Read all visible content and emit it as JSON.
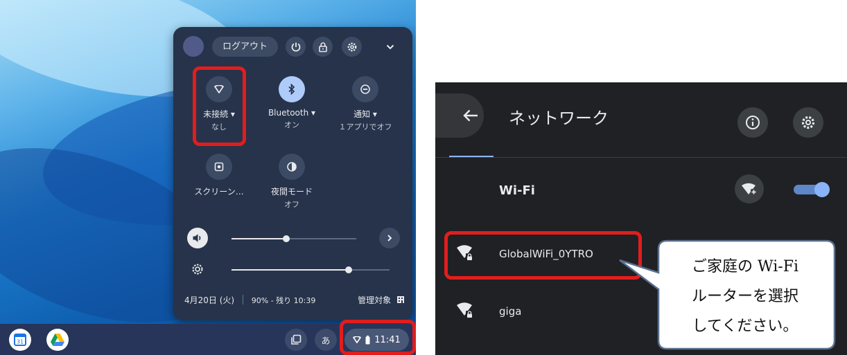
{
  "left": {
    "quick_settings": {
      "logout_label": "ログアウト",
      "icons": [
        "power-icon",
        "lock-icon",
        "settings-icon",
        "chevron-down-icon"
      ],
      "tiles": [
        {
          "id": "network",
          "label": "未接続",
          "sub": "なし",
          "icon": "wifi-icon",
          "active": false,
          "highlighted": true
        },
        {
          "id": "bluetooth",
          "label": "Bluetooth",
          "sub": "オン",
          "icon": "bluetooth-icon",
          "active": true
        },
        {
          "id": "notifications",
          "label": "通知",
          "sub": "１アプリでオフ",
          "icon": "do-not-disturb-icon",
          "active": false
        },
        {
          "id": "screen",
          "label": "スクリーン…",
          "sub": "",
          "icon": "screen-capture-icon",
          "active": false
        },
        {
          "id": "night",
          "label": "夜間モード",
          "sub": "オフ",
          "icon": "night-light-icon",
          "active": false
        }
      ],
      "volume_level": 0.44,
      "brightness_level": 0.74,
      "footer": {
        "date": "4月20日 (火)",
        "battery": "90% - 残り 10:39",
        "managed": "管理対象"
      }
    },
    "taskbar": {
      "apps": [
        "calendar-app-icon",
        "drive-app-icon"
      ],
      "ime_label": "あ",
      "time": "11:41"
    },
    "highlight_color": "#e21d1d"
  },
  "right": {
    "title": "ネットワーク",
    "wifi_label": "Wi-Fi",
    "wifi_enabled": true,
    "networks": [
      {
        "name": "GlobalWiFi_0YTRO",
        "secured": true,
        "highlighted": true
      },
      {
        "name": "giga",
        "secured": true,
        "highlighted": false
      }
    ],
    "callout": {
      "line1": "ご家庭の Wi-Fi",
      "line2": "ルーターを選択",
      "line3": "してください。"
    }
  }
}
